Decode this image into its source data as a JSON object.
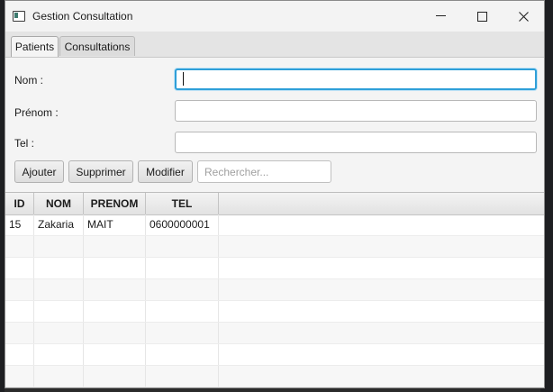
{
  "window": {
    "title": "Gestion Consultation",
    "minimize_glyph": "—",
    "maximize_glyph": "☐",
    "close_glyph": "✕"
  },
  "tabs": [
    {
      "label": "Patients",
      "active": true
    },
    {
      "label": "Consultations",
      "active": false
    }
  ],
  "form": {
    "nom_label": "Nom :",
    "nom_value": "",
    "prenom_label": "Prénom :",
    "prenom_value": "",
    "tel_label": "Tel :",
    "tel_value": ""
  },
  "toolbar": {
    "add_label": "Ajouter",
    "delete_label": "Supprimer",
    "edit_label": "Modifier",
    "search_placeholder": "Rechercher..."
  },
  "table": {
    "columns": [
      "ID",
      "NOM",
      "PRENOM",
      "TEL"
    ],
    "rows": [
      [
        "15",
        "Zakaria",
        "MAIT",
        "0600000001"
      ]
    ]
  },
  "colors": {
    "focus_accent": "#2f9fd8",
    "window_bg": "#f4f4f4"
  }
}
